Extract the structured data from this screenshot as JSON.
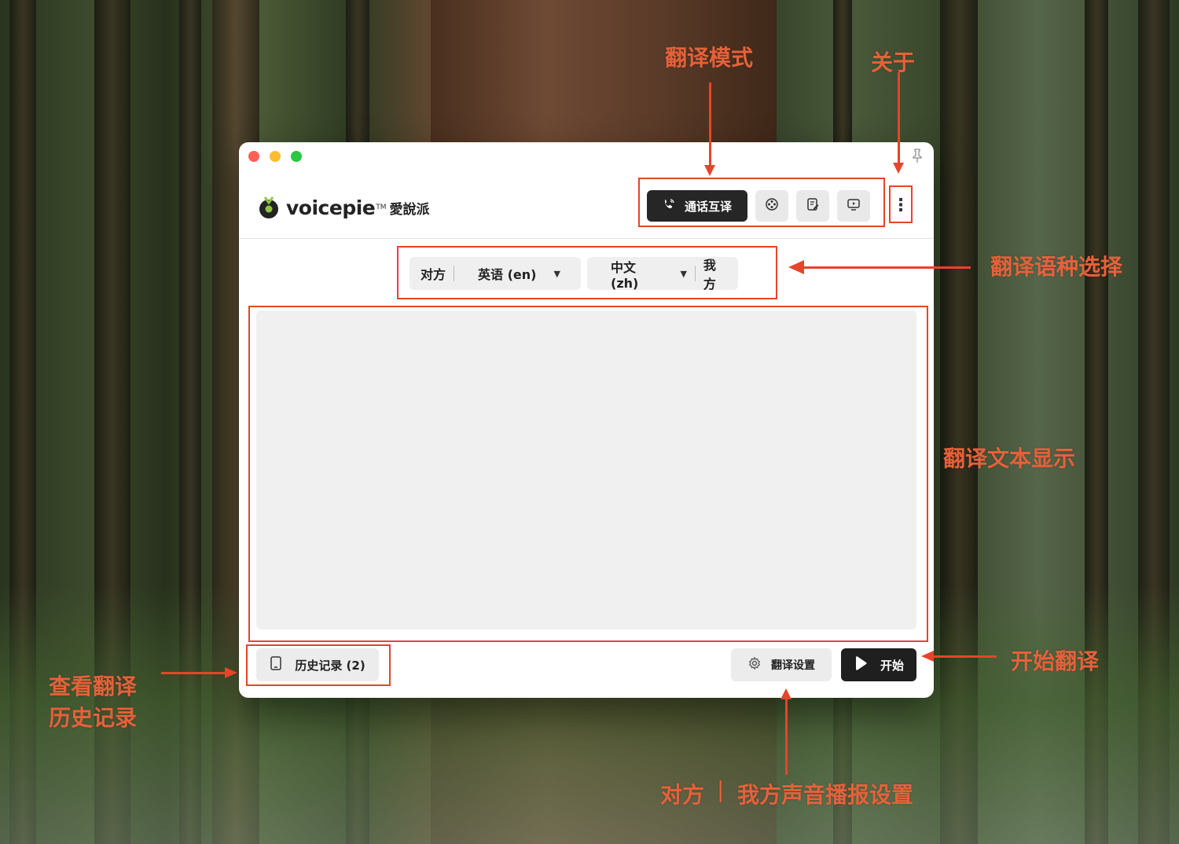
{
  "window": {
    "traffic_colors": [
      "#ff5f57",
      "#febc2e",
      "#28c840"
    ]
  },
  "logo": {
    "name": "voicepie",
    "tm": "TM",
    "cn": "愛說派"
  },
  "modes": {
    "primary_label": "通话互译",
    "icons": [
      "phone-icon",
      "film-reel-icon",
      "document-edit-icon",
      "screen-play-icon"
    ]
  },
  "menu": {
    "glyph": "⋮"
  },
  "languages": {
    "left_role": "对方",
    "left_language": "英语 (en)",
    "right_language": "中文 (zh)",
    "right_role": "我方",
    "caret": "▼"
  },
  "footer": {
    "history_label": "历史记录 (2)",
    "settings_label": "翻译设置",
    "start_label": "开始"
  },
  "annotations": {
    "mode": "翻译模式",
    "about": "关于",
    "language_select": "翻译语种选择",
    "text_display": "翻译文本显示",
    "start": "开始翻译",
    "history_line1": "查看翻译",
    "history_line2": "历史记录",
    "voice_left": "对方",
    "voice_sep": "|",
    "voice_right": "我方声音播报设置"
  },
  "colors": {
    "annotation": "#e6613a",
    "highlight_box": "#e4452b",
    "primary_button": "#262626"
  }
}
